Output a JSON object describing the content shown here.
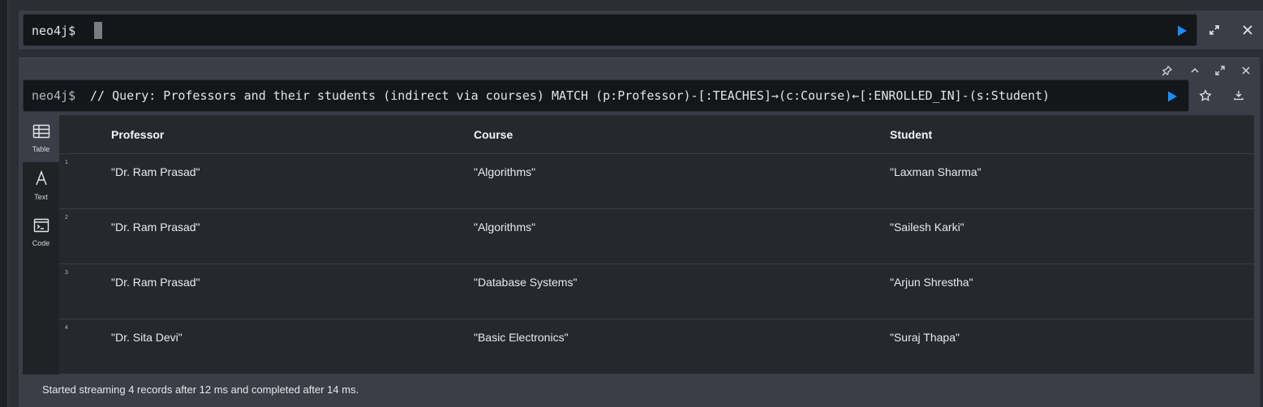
{
  "top_editor": {
    "prompt": "neo4j$",
    "run_icon": "play-icon"
  },
  "top_actions": {
    "expand_icon": "expand-icon",
    "close_icon": "close-icon"
  },
  "frame": {
    "controls": [
      "pin-icon",
      "collapse-icon",
      "fullscreen-icon",
      "close-icon"
    ],
    "prompt": "neo4j$",
    "query": "// Query: Professors and their students (indirect via courses) MATCH (p:Professor)-[:TEACHES]→(c:Course)←[:ENROLLED_IN]-(s:Student)",
    "favorite_icon": "star-icon",
    "download_icon": "download-icon"
  },
  "views": [
    {
      "label": "Table",
      "icon": "table-icon",
      "active": true
    },
    {
      "label": "Text",
      "icon": "text-icon",
      "active": false
    },
    {
      "label": "Code",
      "icon": "code-icon",
      "active": false
    }
  ],
  "table": {
    "columns": [
      "Professor",
      "Course",
      "Student"
    ],
    "rows": [
      {
        "num": "1",
        "cells": [
          "\"Dr. Ram Prasad\"",
          "\"Algorithms\"",
          "\"Laxman Sharma\""
        ]
      },
      {
        "num": "2",
        "cells": [
          "\"Dr. Ram Prasad\"",
          "\"Algorithms\"",
          "\"Sailesh Karki\""
        ]
      },
      {
        "num": "3",
        "cells": [
          "\"Dr. Ram Prasad\"",
          "\"Database Systems\"",
          "\"Arjun Shrestha\""
        ]
      },
      {
        "num": "4",
        "cells": [
          "\"Dr. Sita Devi\"",
          "\"Basic Electronics\"",
          "\"Suraj Thapa\""
        ]
      }
    ]
  },
  "status": "Started streaming 4 records after 12 ms and completed after 14 ms.",
  "colors": {
    "accent": "#1a8cff",
    "background": "#2b2e35",
    "editor": "#151619"
  }
}
